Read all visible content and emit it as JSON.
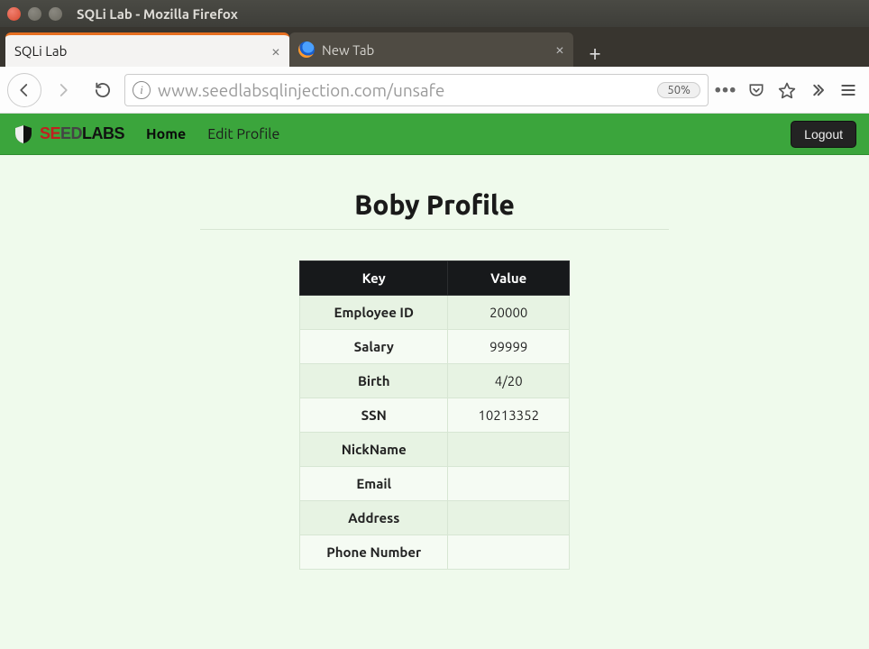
{
  "os": {
    "window_title": "SQLi Lab - Mozilla Firefox"
  },
  "tabs": [
    {
      "label": "SQLi Lab",
      "active": true
    },
    {
      "label": "New Tab",
      "active": false
    }
  ],
  "urlbar": {
    "url_display": "www.seedlabsqlinjection.com/unsafe",
    "zoom": "50%"
  },
  "navbar": {
    "brand_seg1": "SE",
    "brand_seg2": "ED",
    "brand_seg3": "LABS",
    "links": {
      "home": "Home",
      "edit": "Edit Profile"
    },
    "logout": "Logout"
  },
  "profile": {
    "title": "Boby Profile",
    "columns": {
      "key": "Key",
      "value": "Value"
    },
    "rows": [
      {
        "key": "Employee ID",
        "value": "20000"
      },
      {
        "key": "Salary",
        "value": "99999"
      },
      {
        "key": "Birth",
        "value": "4/20"
      },
      {
        "key": "SSN",
        "value": "10213352"
      },
      {
        "key": "NickName",
        "value": ""
      },
      {
        "key": "Email",
        "value": ""
      },
      {
        "key": "Address",
        "value": ""
      },
      {
        "key": "Phone Number",
        "value": ""
      }
    ]
  }
}
